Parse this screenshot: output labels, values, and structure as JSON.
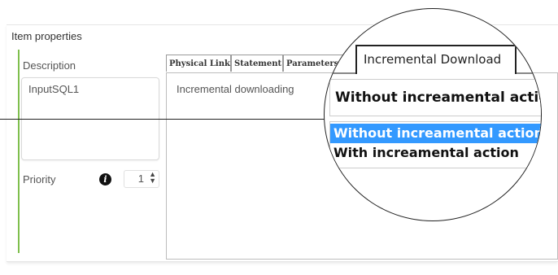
{
  "panel": {
    "title": "Item properties",
    "description_label": "Description",
    "description_value": "InputSQL1",
    "priority_label": "Priority",
    "priority_value": "1",
    "info_glyph": "i"
  },
  "tabs": [
    {
      "label": "Physical Link"
    },
    {
      "label": "Statement"
    },
    {
      "label": "Parameters"
    },
    {
      "label": "Incremental Download"
    }
  ],
  "tab_content": {
    "incremental_label": "Incremental downloading"
  },
  "magnifier": {
    "tab_label": "Incremental Download",
    "select_value": "Without increamental action",
    "options": [
      {
        "label": "Without increamental action",
        "selected": true
      },
      {
        "label": "With increamental action",
        "selected": false
      }
    ]
  },
  "colors": {
    "accent_green": "#7fbf4d",
    "selection_blue": "#3399ff"
  },
  "icons": {
    "info": "info-icon",
    "spinner": "up-down-spinner-icon"
  }
}
